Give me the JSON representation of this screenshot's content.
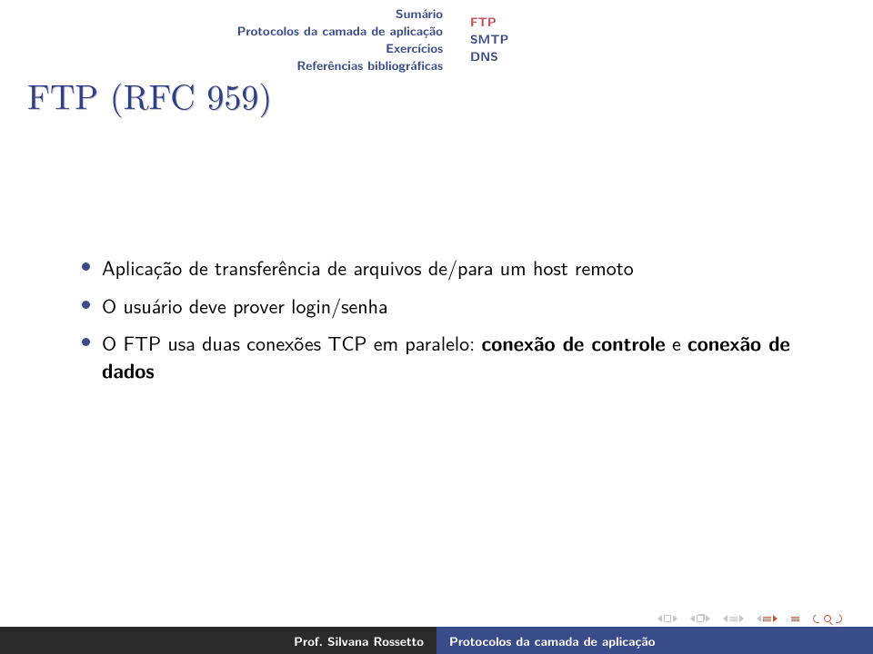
{
  "header": {
    "sections": [
      "Sumário",
      "Protocolos da camada de aplicação",
      "Exercícios",
      "Referências bibliográficas"
    ],
    "subsections": {
      "current": "FTP",
      "others": [
        "SMTP",
        "DNS"
      ]
    }
  },
  "title": "FTP (RFC 959)",
  "bullets": [
    {
      "text": "Aplicação de transferência de arquivos de/para um host remoto"
    },
    {
      "text": "O usuário deve prover login/senha"
    },
    {
      "prefix": "O FTP usa duas conexões TCP em paralelo: ",
      "bold1": "conexão de controle",
      "mid": " e ",
      "bold2": "conexão de dados"
    }
  ],
  "footer": {
    "author": "Prof. Silvana Rossetto",
    "title": "Protocolos da camada de aplicação"
  }
}
